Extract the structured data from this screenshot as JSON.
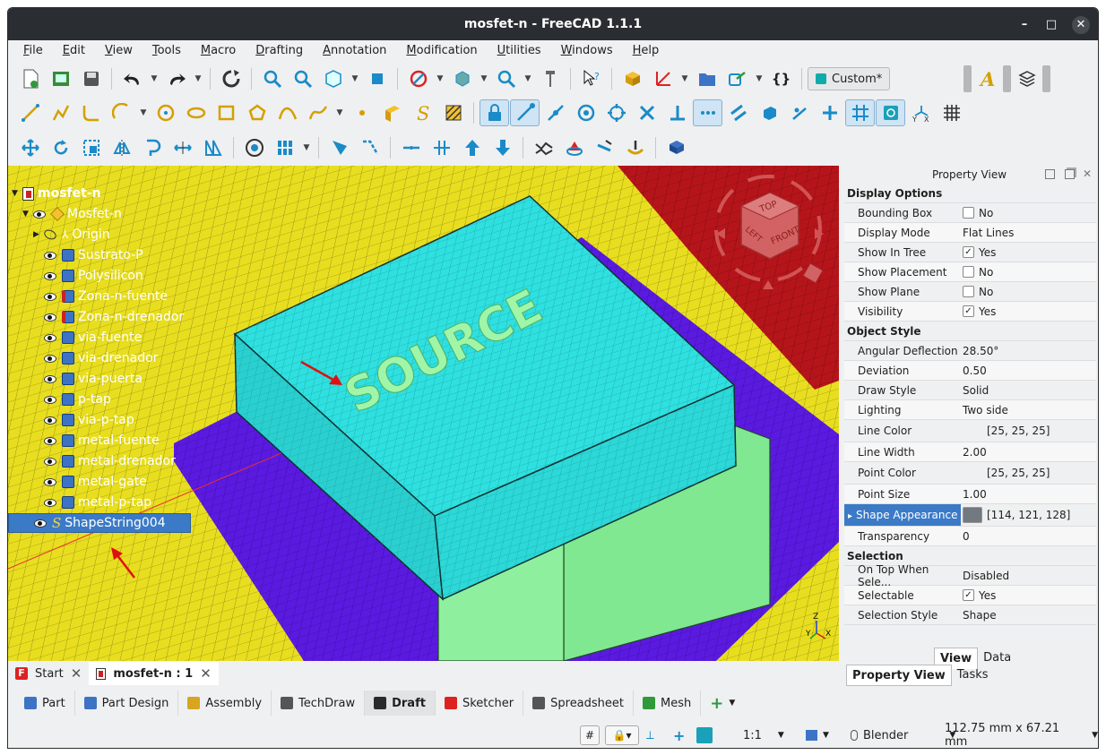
{
  "window": {
    "title": "mosfet-n - FreeCAD 1.1.1",
    "minimize": "–",
    "maximize": "□",
    "close": "✕"
  },
  "menu": [
    "File",
    "Edit",
    "View",
    "Tools",
    "Macro",
    "Drafting",
    "Annotation",
    "Modification",
    "Utilities",
    "Windows",
    "Help"
  ],
  "toolbar": {
    "workbench_selector": "Custom*",
    "braces": "{}"
  },
  "tree": {
    "root": "mosfet-n",
    "body": "Mosfet-n",
    "origin": "Origin",
    "items": [
      "Sustrato-P",
      "Polysilicon",
      "Zona-n-fuente",
      "Zona-n-drenador",
      "via-fuente",
      "via-drenador",
      "via-puerta",
      "p-tap",
      "via-p-tap",
      "metal-fuente",
      "metal-drenador",
      "metal-gate",
      "metal-p-tap"
    ],
    "selected": "ShapeString004"
  },
  "viewport": {
    "text_3d": "SOURCE",
    "navcube": {
      "top": "TOP",
      "front": "FRONT",
      "left": "LEFT"
    },
    "axis": {
      "x": "X",
      "y": "Y",
      "z": "Z"
    },
    "colors": {
      "yellow_plane": "#e8de1f",
      "purple_plane": "#5a1ae0",
      "cyan_block": "#2fe0e0",
      "green_block": "#7fe890",
      "red_plane": "#b5151a"
    }
  },
  "property_view": {
    "title": "Property View",
    "groups": [
      {
        "name": "Display Options",
        "rows": [
          {
            "key": "Bounding Box",
            "value": "No",
            "checkbox": false
          },
          {
            "key": "Display Mode",
            "value": "Flat Lines"
          },
          {
            "key": "Show In Tree",
            "value": "Yes",
            "checkbox": true
          },
          {
            "key": "Show Placement",
            "value": "No",
            "checkbox": false
          },
          {
            "key": "Show Plane",
            "value": "No",
            "checkbox": false
          },
          {
            "key": "Visibility",
            "value": "Yes",
            "checkbox": true
          }
        ]
      },
      {
        "name": "Object Style",
        "rows": [
          {
            "key": "Angular Deflection",
            "value": "28.50°"
          },
          {
            "key": "Deviation",
            "value": "0.50"
          },
          {
            "key": "Draw Style",
            "value": "Solid"
          },
          {
            "key": "Lighting",
            "value": "Two side"
          },
          {
            "key": "Line Color",
            "value": "[25, 25, 25]",
            "swatch": "#191919"
          },
          {
            "key": "Line Width",
            "value": "2.00"
          },
          {
            "key": "Point Color",
            "value": "[25, 25, 25]",
            "swatch": "#191919"
          },
          {
            "key": "Point Size",
            "value": "1.00"
          },
          {
            "key": "Shape Appearance",
            "value": "[114, 121, 128]",
            "swatch": "#727980"
          },
          {
            "key": "Transparency",
            "value": "0"
          }
        ]
      },
      {
        "name": "Selection",
        "rows": [
          {
            "key": "On Top When Sele...",
            "value": "Disabled"
          },
          {
            "key": "Selectable",
            "value": "Yes",
            "checkbox": true
          },
          {
            "key": "Selection Style",
            "value": "Shape"
          }
        ]
      }
    ],
    "tabs": [
      "View",
      "Data"
    ]
  },
  "doc_tabs": [
    {
      "label": "Start"
    },
    {
      "label": "mosfet-n : 1"
    }
  ],
  "lower_tabs": [
    "Property View",
    "Tasks"
  ],
  "workbenches": [
    {
      "label": "Part",
      "color": "#3d73c5"
    },
    {
      "label": "Part Design",
      "color": "#3d73c5"
    },
    {
      "label": "Assembly",
      "color": "#d8a520"
    },
    {
      "label": "TechDraw",
      "color": "#555555"
    },
    {
      "label": "Draft",
      "color": "#2a2a2a"
    },
    {
      "label": "Sketcher",
      "color": "#d22"
    },
    {
      "label": "Spreadsheet",
      "color": "#555555"
    },
    {
      "label": "Mesh",
      "color": "#2e9a3a"
    }
  ],
  "statusbar": {
    "scale": "1:1",
    "nav_style": "Blender",
    "dimensions": "112.75 mm x 67.21 mm"
  }
}
